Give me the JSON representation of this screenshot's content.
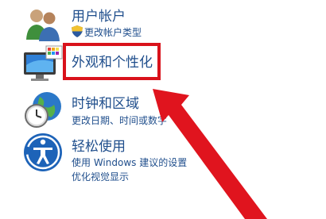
{
  "categories": [
    {
      "id": "user-accounts",
      "icon": "user-accounts-icon",
      "title": "用户帐户",
      "links": [
        "更改帐户类型"
      ]
    },
    {
      "id": "appearance",
      "icon": "appearance-monitor-icon",
      "title": "外观和个性化",
      "links": []
    },
    {
      "id": "clock-region",
      "icon": "clock-globe-icon",
      "title": "时钟和区域",
      "links": [
        "更改日期、时间或数字"
      ]
    },
    {
      "id": "ease-of-access",
      "icon": "ease-of-access-icon",
      "title": "轻松使用",
      "links": [
        "使用 Windows 建议的设置",
        "优化视觉显示"
      ]
    }
  ],
  "annotation": {
    "highlight_color": "#d9121b",
    "arrow_color": "#e0141e"
  },
  "colors": {
    "link": "#1f4e8c"
  }
}
